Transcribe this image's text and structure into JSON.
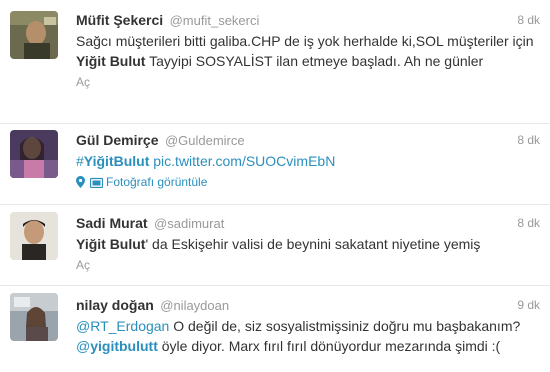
{
  "colors": {
    "link": "#2a8fbd",
    "text": "#333333",
    "muted": "#999999"
  },
  "tweets": [
    {
      "fullname": "Müfit Şekerci",
      "username": "@mufit_sekerci",
      "time": "8 dk",
      "text_parts": {
        "a": "Sağcı müşterileri bitti galiba.CHP de iş yok herhalde ki,SOL müşteriler için ",
        "b": "Yiğit Bulut",
        "c": " Tayyipi SOSYALİST ilan etmeye başladı. Ah ne günler"
      },
      "action": "Aç"
    },
    {
      "fullname": "Gül Demirçe",
      "username": "@Guldemirce",
      "time": "8 dk",
      "hashtag_symbol": "#",
      "hashtag": "YiğitBulut",
      "link": "pic.twitter.com/SUOCvimEbN",
      "media_action": "Fotoğrafı görüntüle",
      "icons": [
        "location-pin-icon",
        "photo-icon"
      ]
    },
    {
      "fullname": "Sadi Murat",
      "username": "@sadimurat",
      "time": "8 dk",
      "text_parts": {
        "a": "Yiğit Bulut",
        "b": "' da Eskişehir valisi de beynini sakatant niyetine yemiş"
      },
      "action": "Aç"
    },
    {
      "fullname": "nilay doğan",
      "username": "@nilaydoan",
      "time": "9 dk",
      "text_parts": {
        "mention1": "@RT_Erdogan",
        "a": " O değil de, siz sosyalistmişsiniz doğru mu başbakanım? ",
        "mention2_at": "@",
        "mention2": "yigitbulutt",
        "b": " öyle diyor. Marx fırıl fırıl dönüyordur mezarında şimdi :("
      }
    }
  ]
}
